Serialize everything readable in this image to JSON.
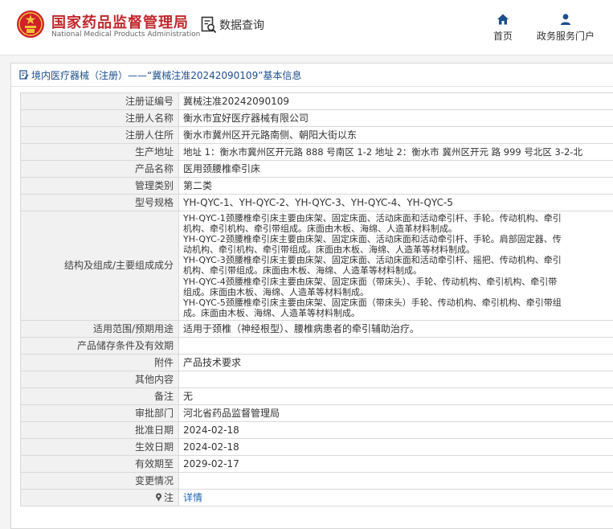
{
  "header": {
    "brand_cn": "国家药品监督管理局",
    "brand_en": "National Medical Products Administration",
    "query_label": "数据查询",
    "nav_home": "首页",
    "nav_portal": "政务服务门户"
  },
  "panel": {
    "breadcrumb": "境内医疗器械（注册）——“冀械注准20242090109”基本信息"
  },
  "rows": [
    {
      "label": "注册证编号",
      "value": "冀械注准20242090109"
    },
    {
      "label": "注册人名称",
      "value": "衡水市宜好医疗器械有限公司"
    },
    {
      "label": "注册人住所",
      "value": "衡水市冀州区开元路南侧、朝阳大街以东"
    },
    {
      "label": "生产地址",
      "value": "地址 1：衡水市冀州区开元路 888 号南区 1-2 地址 2：衡水市 冀州区开元 路 999 号北区 3-2-北"
    },
    {
      "label": "产品名称",
      "value": "医用颈腰椎牵引床"
    },
    {
      "label": "管理类别",
      "value": "第二类"
    },
    {
      "label": "型号规格",
      "value": "YH-QYC-1、YH-QYC-2、YH-QYC-3、YH-QYC-4、YH-QYC-5"
    },
    {
      "label": "结构及组成/主要组成成分",
      "lines": [
        "YH-QYC-1颈腰椎牵引床主要由床架、固定床面、活动床面和活动牵引杆、手轮。传动机构、牵引",
        "机构、牵引机构、牵引带组成。床面由木板、海绵、人造革材料制成。",
        "YH-QYC-2颈腰椎牵引床主要由床架、固定床面、活动床面和活动牵引杆、手轮。肩部固定器、传",
        "动机构、牵引机构、牵引带组成。床面由木板、海绵、人造革等材料制成。",
        "YH-QYC-3颈腰椎牵引床主要由床架、固定床面、活动床面和活动牵引杆、摇把、传动机构、牵引",
        "机构、牵引带组成。床面由木板、海绵、人造革等材料制成。",
        "YH-QYC-4颈腰椎牵引床主要由床架、固定床面（带床头）、手轮、传动机构、牵引机构、牵引带",
        "组成。床面由木板、海绵、人造革等材料制成。",
        "YH-QYC-5颈腰椎牵引床主要由床架、固定床面（带床头）手轮、传动机构、牵引机构、牵引带组",
        "成。床面由木板、海绵、人造革等材料制成。"
      ]
    },
    {
      "label": "适用范围/预期用途",
      "value": "适用于颈椎（神经根型）、腰椎病患者的牵引辅助治疗。"
    },
    {
      "label": "产品储存条件及有效期",
      "value": ""
    },
    {
      "label": "附件",
      "value": "产品技术要求"
    },
    {
      "label": "其他内容",
      "value": ""
    },
    {
      "label": "备注",
      "value": "无"
    },
    {
      "label": "审批部门",
      "value": "河北省药品监督管理局"
    },
    {
      "label": "批准日期",
      "value": "2024-02-18"
    },
    {
      "label": "生效日期",
      "value": "2024-02-18"
    },
    {
      "label": "有效期至",
      "value": "2029-02-17"
    },
    {
      "label": "变更情况",
      "value": ""
    },
    {
      "label": "注",
      "value": "详情",
      "icon": "pin-icon",
      "link": true
    }
  ],
  "colors": {
    "brand_red": "#c0282d",
    "nav_blue": "#1d4f8c",
    "link_blue": "#1f63b8"
  }
}
